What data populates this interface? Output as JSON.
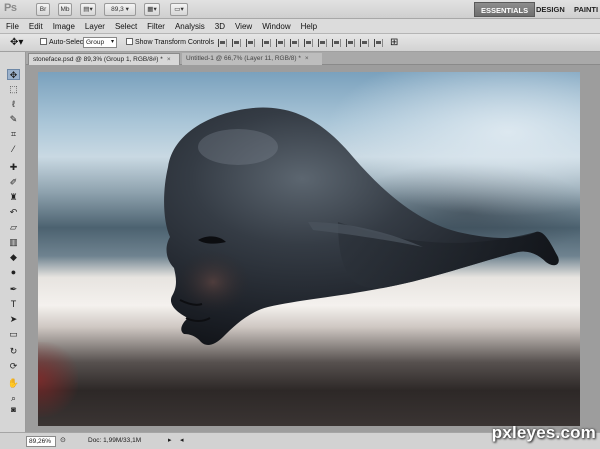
{
  "app": {
    "logo": "Ps",
    "zoom": "89,3",
    "workspaces": [
      "ESSENTIALS",
      "DESIGN",
      "PAINTI"
    ]
  },
  "menu": [
    "File",
    "Edit",
    "Image",
    "Layer",
    "Select",
    "Filter",
    "Analysis",
    "3D",
    "View",
    "Window",
    "Help"
  ],
  "options": {
    "auto_select_label": "Auto-Select:",
    "auto_select_value": "Group",
    "show_transform_label": "Show Transform Controls"
  },
  "tabs": [
    {
      "label": "stoneface.psd @ 89,3% (Group 1, RGB/8#) *",
      "close": "×"
    },
    {
      "label": "Untitled-1 @ 66,7% (Layer 11, RGB/8) *",
      "close": "×"
    }
  ],
  "status": {
    "zoom": "89,26%",
    "doc": "Doc: 1,99M/33,1M"
  },
  "watermark": "pxleyes.com",
  "colors": {
    "active_tab": "#d7d7d7",
    "tool_highlight": "#9cb2cc",
    "statue": "#2a3038"
  }
}
